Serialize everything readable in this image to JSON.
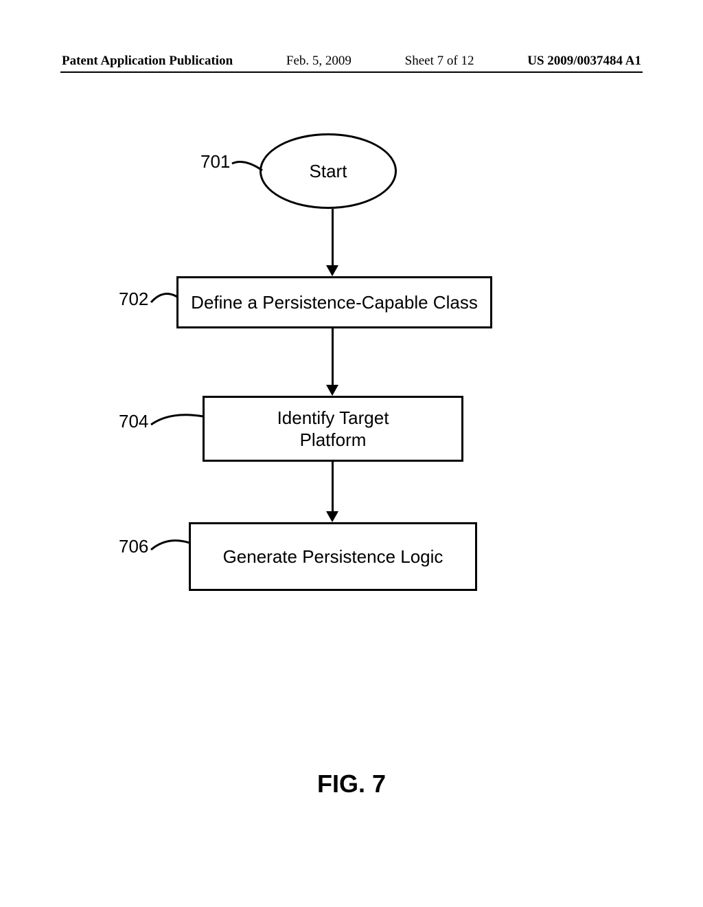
{
  "header": {
    "publication_label": "Patent Application Publication",
    "date": "Feb. 5, 2009",
    "sheet": "Sheet 7 of 12",
    "pub_number": "US 2009/0037484 A1"
  },
  "figure": {
    "title": "FIG. 7"
  },
  "flowchart": {
    "start": {
      "ref": "701",
      "label": "Start"
    },
    "steps": [
      {
        "ref": "702",
        "label": "Define a Persistence-Capable Class"
      },
      {
        "ref": "704",
        "label": "Identify Target\nPlatform"
      },
      {
        "ref": "706",
        "label": "Generate Persistence Logic"
      }
    ]
  },
  "chart_data": {
    "type": "flowchart",
    "title": "FIG. 7",
    "nodes": [
      {
        "id": "701",
        "shape": "terminator",
        "label": "Start"
      },
      {
        "id": "702",
        "shape": "process",
        "label": "Define a Persistence-Capable Class"
      },
      {
        "id": "704",
        "shape": "process",
        "label": "Identify Target Platform"
      },
      {
        "id": "706",
        "shape": "process",
        "label": "Generate Persistence Logic"
      }
    ],
    "edges": [
      {
        "from": "701",
        "to": "702"
      },
      {
        "from": "702",
        "to": "704"
      },
      {
        "from": "704",
        "to": "706"
      }
    ]
  }
}
